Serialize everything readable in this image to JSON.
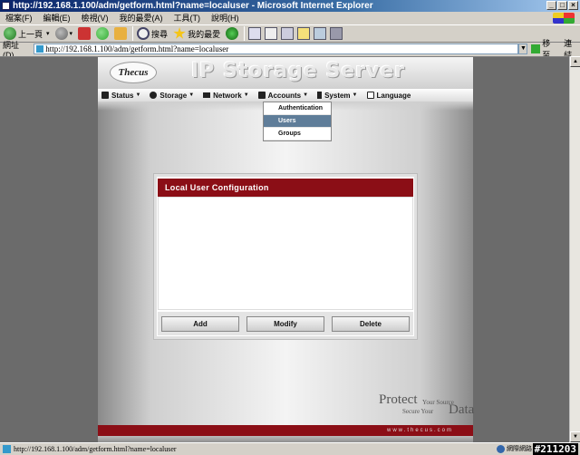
{
  "window": {
    "title": "http://192.168.1.100/adm/getform.html?name=localuser - Microsoft Internet Explorer",
    "controls": [
      "_",
      "□",
      "×"
    ]
  },
  "menubar": [
    "檔案(F)",
    "編輯(E)",
    "檢視(V)",
    "我的最愛(A)",
    "工具(T)",
    "說明(H)"
  ],
  "toolbar": {
    "back_label": "上一頁",
    "search_label": "搜尋",
    "favorites_label": "我的最愛"
  },
  "addressbar": {
    "label": "網址(D)",
    "url": "http://192.168.1.100/adm/getform.html?name=localuser",
    "go_label": "移至",
    "links_label": "連結"
  },
  "site": {
    "logo": "Thecus",
    "title": "IP Storage Server",
    "nav": [
      {
        "label": "Status",
        "icon": "wrench-icon"
      },
      {
        "label": "Storage",
        "icon": "disk-icon"
      },
      {
        "label": "Network",
        "icon": "network-icon"
      },
      {
        "label": "Accounts",
        "icon": "accounts-icon"
      },
      {
        "label": "System",
        "icon": "tools-icon"
      },
      {
        "label": "Language",
        "icon": "language-icon"
      }
    ],
    "accounts_menu": {
      "items": [
        "Authentication",
        "Users",
        "Groups"
      ],
      "active": "Users"
    },
    "panel": {
      "title": "Local User Configuration",
      "buttons": {
        "add": "Add",
        "modify": "Modify",
        "delete": "Delete"
      }
    },
    "tagline": {
      "protect": "Protect",
      "your_source": "Your Source",
      "secure_your": "Secure Your",
      "data": "Data"
    },
    "footer_url": "www.thecus.com"
  },
  "statusbar": {
    "url": "http://192.168.1.100/adm/getform.html?name=localuser",
    "zone": "網際網路",
    "stamp": "#211203"
  },
  "colors": {
    "brand_red": "#8b0e16",
    "menu_active": "#5f7d99"
  }
}
